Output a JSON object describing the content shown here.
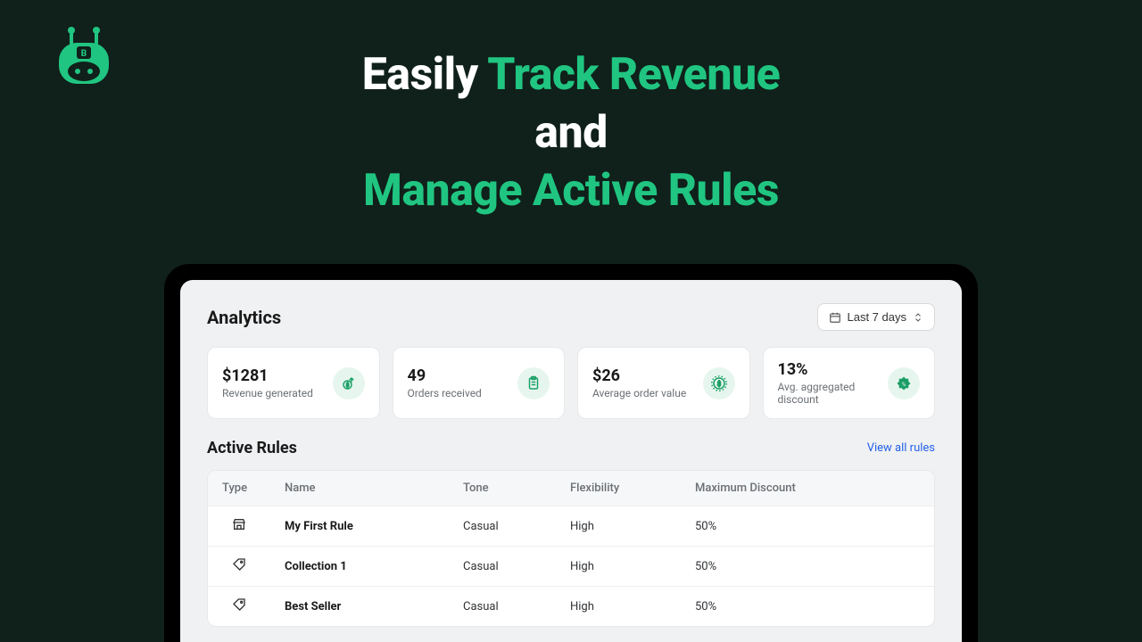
{
  "hero": {
    "line1_white": "Easily ",
    "line1_green": "Track Revenue",
    "line2_white": "and",
    "line3_green": "Manage Active Rules"
  },
  "analytics": {
    "title": "Analytics",
    "date_range_label": "Last 7 days",
    "kpis": [
      {
        "value": "$1281",
        "label": "Revenue generated",
        "icon": "money-up-icon"
      },
      {
        "value": "49",
        "label": "Orders received",
        "icon": "clipboard-icon"
      },
      {
        "value": "$26",
        "label": "Average order value",
        "icon": "dollar-circle-icon"
      },
      {
        "value": "13%",
        "label": "Avg. aggregated discount",
        "icon": "percent-badge-icon"
      }
    ]
  },
  "rules": {
    "title": "Active Rules",
    "view_all_label": "View all rules",
    "columns": {
      "type": "Type",
      "name": "Name",
      "tone": "Tone",
      "flexibility": "Flexibility",
      "max_discount": "Maximum Discount"
    },
    "rows": [
      {
        "type_icon": "store-icon",
        "name": "My First Rule",
        "tone": "Casual",
        "flexibility": "High",
        "max_discount": "50%"
      },
      {
        "type_icon": "tag-icon",
        "name": "Collection 1",
        "tone": "Casual",
        "flexibility": "High",
        "max_discount": "50%"
      },
      {
        "type_icon": "tag-icon",
        "name": "Best Seller",
        "tone": "Casual",
        "flexibility": "High",
        "max_discount": "50%"
      }
    ]
  },
  "colors": {
    "accent_green": "#20c581",
    "link_blue": "#2563eb"
  }
}
